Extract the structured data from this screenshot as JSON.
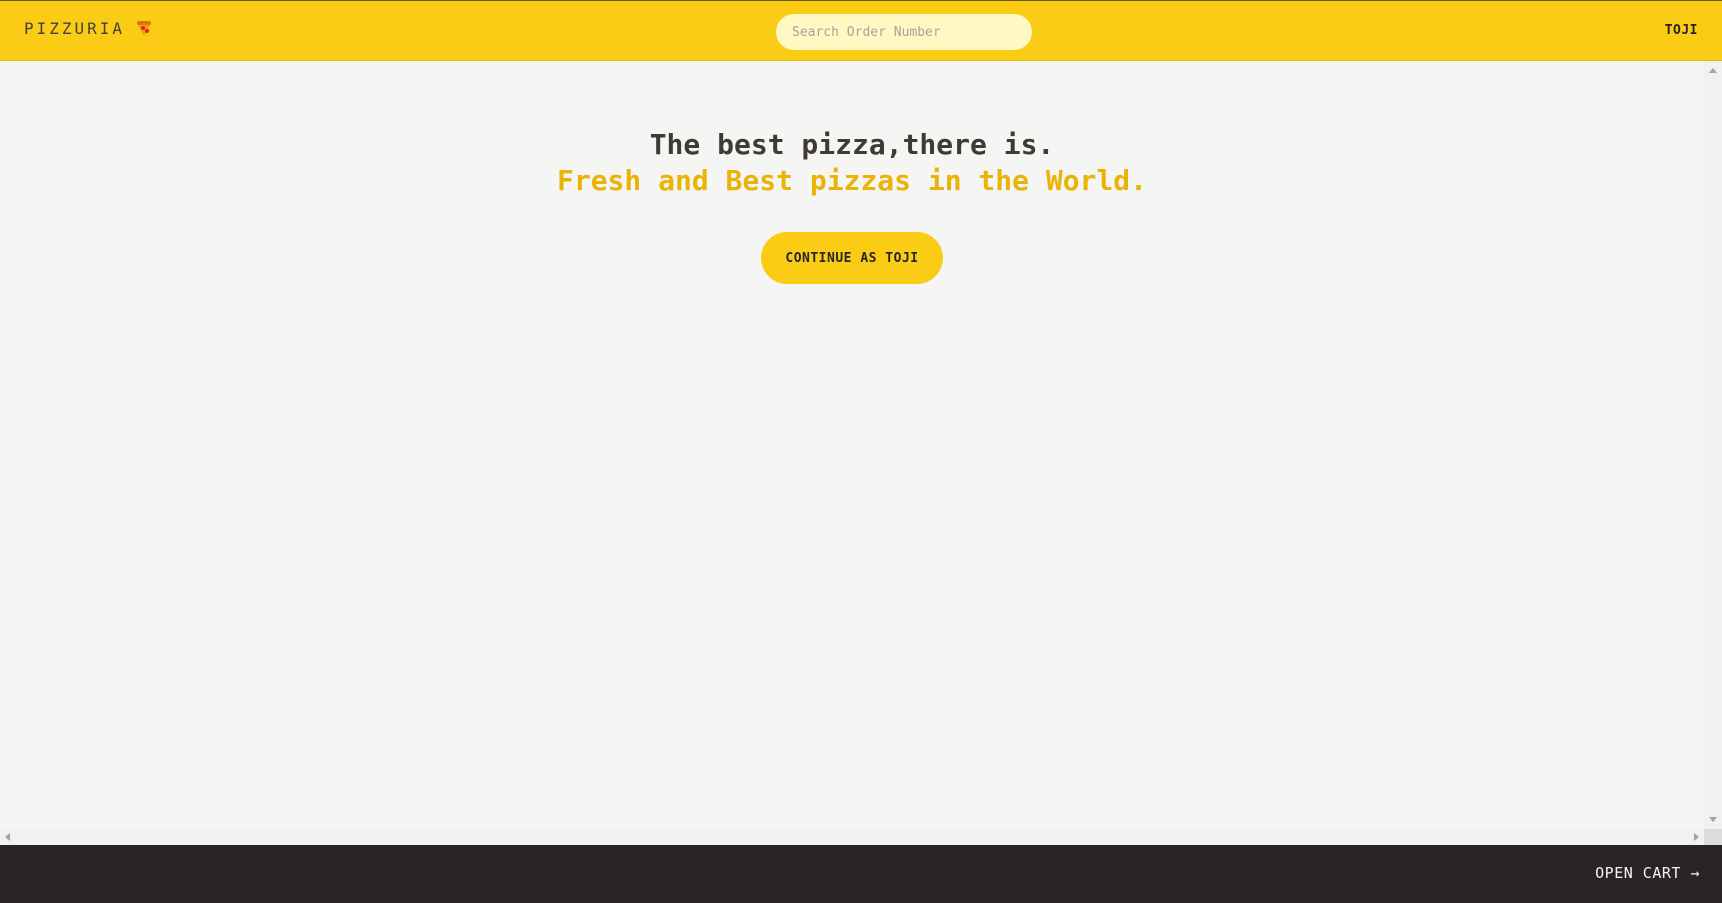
{
  "header": {
    "brand": "PIZZURIA",
    "brand_icon": "pizza-icon",
    "search_placeholder": "Search Order Number",
    "search_value": "",
    "username": "TOJI"
  },
  "hero": {
    "title_line1": "The best pizza,there is.",
    "title_line2": "Fresh and Best pizzas in the World.",
    "continue_label": "CONTINUE AS TOJI"
  },
  "footer": {
    "open_cart_label": "OPEN CART →"
  },
  "colors": {
    "brand_yellow": "#facc15",
    "accent_yellow": "#eab308",
    "dark": "#292524",
    "background": "#f5f5f4"
  }
}
